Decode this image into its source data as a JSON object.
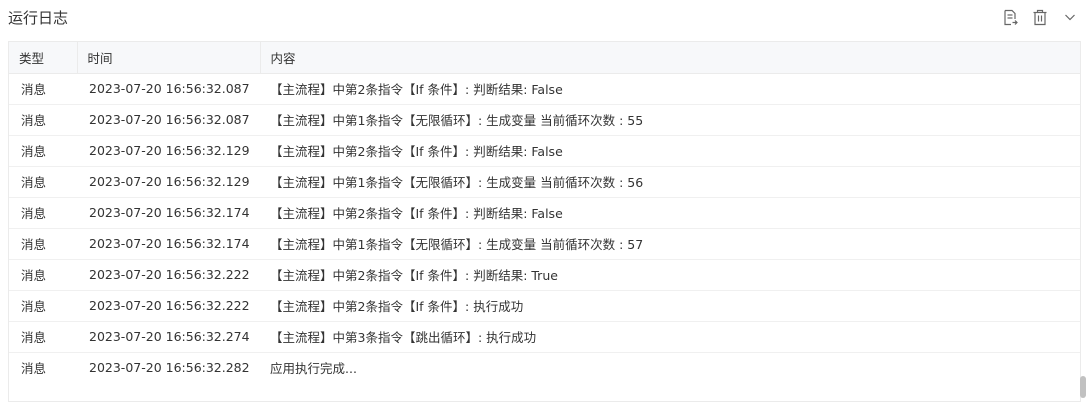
{
  "panel": {
    "title": "运行日志"
  },
  "icons": {
    "export": "export-log-icon",
    "delete": "trash-icon",
    "collapse": "chevron-down-icon"
  },
  "table": {
    "columns": [
      "类型",
      "时间",
      "内容"
    ],
    "rows": [
      {
        "type": "消息",
        "time": "2023-07-20 16:56:32.087",
        "content": "【主流程】中第2条指令【If 条件】: 判断结果:  False"
      },
      {
        "type": "消息",
        "time": "2023-07-20 16:56:32.087",
        "content": "【主流程】中第1条指令【无限循环】: 生成变量 当前循环次数 : 55"
      },
      {
        "type": "消息",
        "time": "2023-07-20 16:56:32.129",
        "content": "【主流程】中第2条指令【If 条件】: 判断结果:  False"
      },
      {
        "type": "消息",
        "time": "2023-07-20 16:56:32.129",
        "content": "【主流程】中第1条指令【无限循环】: 生成变量 当前循环次数 : 56"
      },
      {
        "type": "消息",
        "time": "2023-07-20 16:56:32.174",
        "content": "【主流程】中第2条指令【If 条件】: 判断结果:  False"
      },
      {
        "type": "消息",
        "time": "2023-07-20 16:56:32.174",
        "content": "【主流程】中第1条指令【无限循环】: 生成变量 当前循环次数 : 57"
      },
      {
        "type": "消息",
        "time": "2023-07-20 16:56:32.222",
        "content": "【主流程】中第2条指令【If 条件】: 判断结果:  True"
      },
      {
        "type": "消息",
        "time": "2023-07-20 16:56:32.222",
        "content": "【主流程】中第2条指令【If 条件】: 执行成功"
      },
      {
        "type": "消息",
        "time": "2023-07-20 16:56:32.274",
        "content": "【主流程】中第3条指令【跳出循环】: 执行成功"
      },
      {
        "type": "消息",
        "time": "2023-07-20 16:56:32.282",
        "content": "应用执行完成..."
      }
    ]
  }
}
